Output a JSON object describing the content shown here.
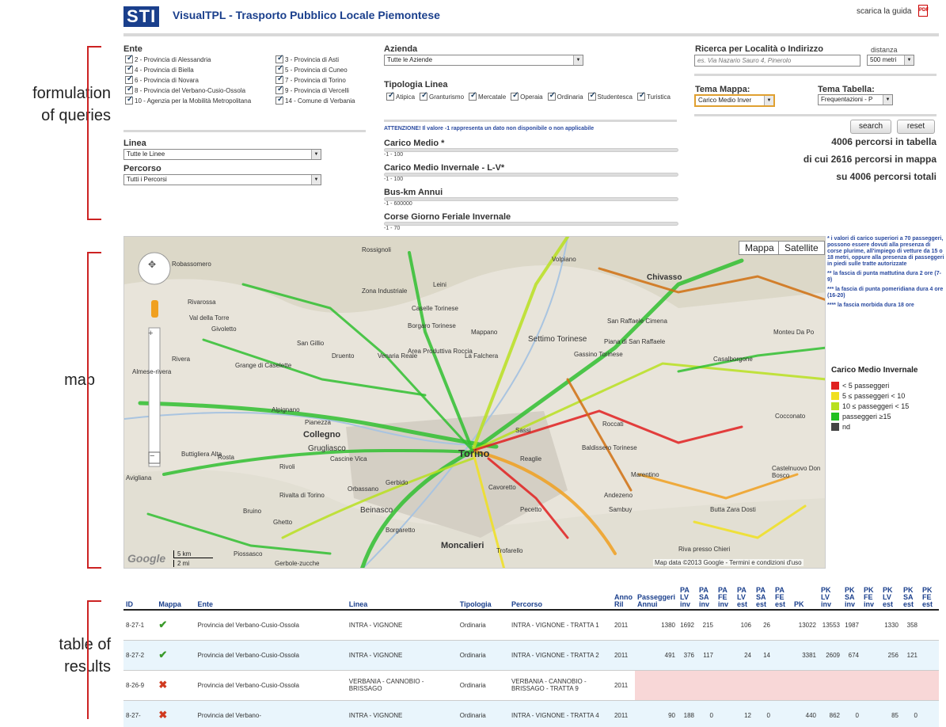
{
  "header": {
    "logo": "STI",
    "title": "VisualTPL - Trasporto Pubblico Locale Piemontese",
    "guide": "scarica la guida",
    "pdf": "PDF"
  },
  "annotations": {
    "queries": "formulation\nof queries",
    "map": "map",
    "table": "table of\nresults"
  },
  "ente": {
    "label": "Ente",
    "items": [
      "2 - Provincia di Alessandria",
      "3 - Provincia di Asti",
      "4 - Provincia di Biella",
      "5 - Provincia di Cuneo",
      "6 - Provincia di Novara",
      "7 - Provincia di Torino",
      "8 - Provincia del Verbano-Cusio-Ossola",
      "9 - Provincia di Vercelli",
      "10 - Agenzia per la Mobilità Metropolitana",
      "14 - Comune di Verbania"
    ]
  },
  "linea": {
    "label": "Linea",
    "value": "Tutte le Linee"
  },
  "percorso": {
    "label": "Percorso",
    "value": "Tutti i Percorsi"
  },
  "azienda": {
    "label": "Azienda",
    "value": "Tutte le Aziende"
  },
  "tipologia": {
    "label": "Tipologia Linea",
    "items": [
      "Atipica",
      "Granturismo",
      "Mercatale",
      "Operaia",
      "Ordinaria",
      "Studentesca",
      "Turistica"
    ]
  },
  "warning": "ATTENZIONE! Il valore -1 rappresenta un dato non disponibile o non applicabile",
  "sliders": [
    {
      "label": "Carico Medio *",
      "range": "-1 - 100"
    },
    {
      "label": "Carico Medio Invernale - L-V*",
      "range": "-1 - 100"
    },
    {
      "label": "Bus-km Annui",
      "range": "-1 - 600000"
    },
    {
      "label": "Corse Giorno Feriale Invernale",
      "range": "-1 - 70"
    }
  ],
  "ricerca": {
    "label": "Ricerca per Località o Indirizzo",
    "placeholder": "es. Via Nazario Sauro 4, Pinerolo",
    "dist_label": "distanza",
    "dist_value": "500 metri"
  },
  "tema_mappa": {
    "label": "Tema Mappa:",
    "value": "Carico Medio Inver"
  },
  "tema_tabella": {
    "label": "Tema Tabella:",
    "value": "Frequentazioni - P"
  },
  "buttons": {
    "search": "search",
    "reset": "reset"
  },
  "counts": [
    "4006 percorsi in tabella",
    "di cui 2616 percorsi in mappa",
    "su 4006 percorsi totali"
  ],
  "map": {
    "mappa": "Mappa",
    "satellite": "Satellite",
    "attribution": "Map data ©2013 Google - Termini e condizioni d'uso",
    "google": "Google",
    "scale_km": "5 km",
    "scale_mi": "2 mi",
    "places": [
      "Rossignoli",
      "Robassomero",
      "Volpiano",
      "Leini",
      "Chivasso",
      "Rivarossa",
      "Val della Torre",
      "Givoletto",
      "Zona Industriale",
      "Caselle Torinese",
      "Borgaro Torinese",
      "Mappano",
      "Settimo Torinese",
      "San Raffaele Cimena",
      "Piana di San Raffaele",
      "Monteu Da Po",
      "Rivera",
      "Almese-rivera",
      "Grange di Caselette",
      "San Gillio",
      "Druento",
      "Venaria Reale",
      "Area Produttiva Roccia",
      "La Falchera",
      "Gassino Torinese",
      "Casalborgone",
      "Alpignano",
      "Pianezza",
      "Collegno",
      "Grugliasco",
      "Torino",
      "Sassi",
      "Roccati",
      "Reaglie",
      "Baldissero Torinese",
      "Avigliana",
      "Buttigliera Alta",
      "Rosta",
      "Rivoli",
      "Cascine Vica",
      "Gerbido",
      "Cavoretto",
      "Pecetto",
      "Andezeno",
      "Sambuy",
      "Cocconato",
      "Castelnuovo Don Bosco",
      "Rivalta di Torino",
      "Beinasco",
      "Borgaretto",
      "Moncalieri",
      "Trofarello",
      "Riva presso Chieri",
      "Butta Zara Dosti",
      "Ghetto",
      "Piossasco",
      "Gerbole-zucche",
      "Orbassano",
      "Bruino",
      "Marentino"
    ]
  },
  "notes": [
    "* i valori di carico superiori a 70 passeggeri, possono essere dovuti alla presenza di corse plurime, all'impiego di vetture da 15 o 18 metri, oppure alla presenza di passeggeri in piedi sulle tratte autorizzate",
    "** la fascia di punta mattutina dura 2 ore (7-9)",
    "*** la fascia di punta pomeridiana dura 4 ore (16-20)",
    "**** la fascia morbida dura 18 ore"
  ],
  "legend": {
    "title": "Carico Medio Invernale",
    "items": [
      {
        "label": "< 5 passeggeri",
        "color": "#e02020"
      },
      {
        "label": "5 ≤ passeggeri < 10",
        "color": "#f0e020"
      },
      {
        "label": "10 ≤ passeggeri < 15",
        "color": "#b8e020"
      },
      {
        "label": "passeggeri ≥15",
        "color": "#20c020"
      },
      {
        "label": "nd",
        "color": "#444444"
      }
    ]
  },
  "table": {
    "headers": [
      "ID",
      "Mappa",
      "Ente",
      "Linea",
      "Tipologia",
      "Percorso",
      "Anno Ril",
      "Passeggeri Annui",
      "PA LV inv",
      "PA SA inv",
      "PA FE inv",
      "PA LV est",
      "PA SA est",
      "PA FE est",
      "PK",
      "PK LV inv",
      "PK SA inv",
      "PK FE inv",
      "PK LV est",
      "PK SA est",
      "PK FE est"
    ],
    "rows": [
      {
        "id": "8-27-1",
        "map": "ok",
        "ente": "Provincia del Verbano-Cusio-Ossola",
        "linea": "INTRA - VIGNONE",
        "tipo": "Ordinaria",
        "percorso": "INTRA - VIGNONE - TRATTA 1",
        "anno": "2011",
        "vals": [
          "1380",
          "1692",
          "215",
          "",
          "106",
          "26",
          "",
          "13022",
          "13553",
          "1987",
          "",
          "1330",
          "358",
          ""
        ]
      },
      {
        "id": "8-27-2",
        "map": "ok",
        "ente": "Provincia del Verbano-Cusio-Ossola",
        "linea": "INTRA - VIGNONE",
        "tipo": "Ordinaria",
        "percorso": "INTRA - VIGNONE - TRATTA 2",
        "anno": "2011",
        "vals": [
          "491",
          "376",
          "117",
          "",
          "24",
          "14",
          "",
          "3381",
          "2609",
          "674",
          "",
          "256",
          "121",
          ""
        ]
      },
      {
        "id": "8-26-9",
        "map": "no",
        "ente": "Provincia del Verbano-Cusio-Ossola",
        "linea": "VERBANIA - CANNOBIO - BRISSAGO",
        "tipo": "Ordinaria",
        "percorso": "VERBANIA - CANNOBIO - BRISSAGO - TRATTA 9",
        "anno": "2011",
        "vals": [
          "",
          "",
          "",
          "",
          "",
          "",
          "",
          "",
          "",
          "",
          "",
          "",
          "",
          ""
        ]
      },
      {
        "id": "8-27-",
        "map": "no",
        "ente": "Provincia del Verbano-",
        "linea": "INTRA - VIGNONE",
        "tipo": "Ordinaria",
        "percorso": "INTRA - VIGNONE - TRATTA 4",
        "anno": "2011",
        "vals": [
          "90",
          "188",
          "0",
          "",
          "12",
          "0",
          "",
          "440",
          "862",
          "0",
          "",
          "85",
          "0",
          ""
        ]
      }
    ]
  }
}
